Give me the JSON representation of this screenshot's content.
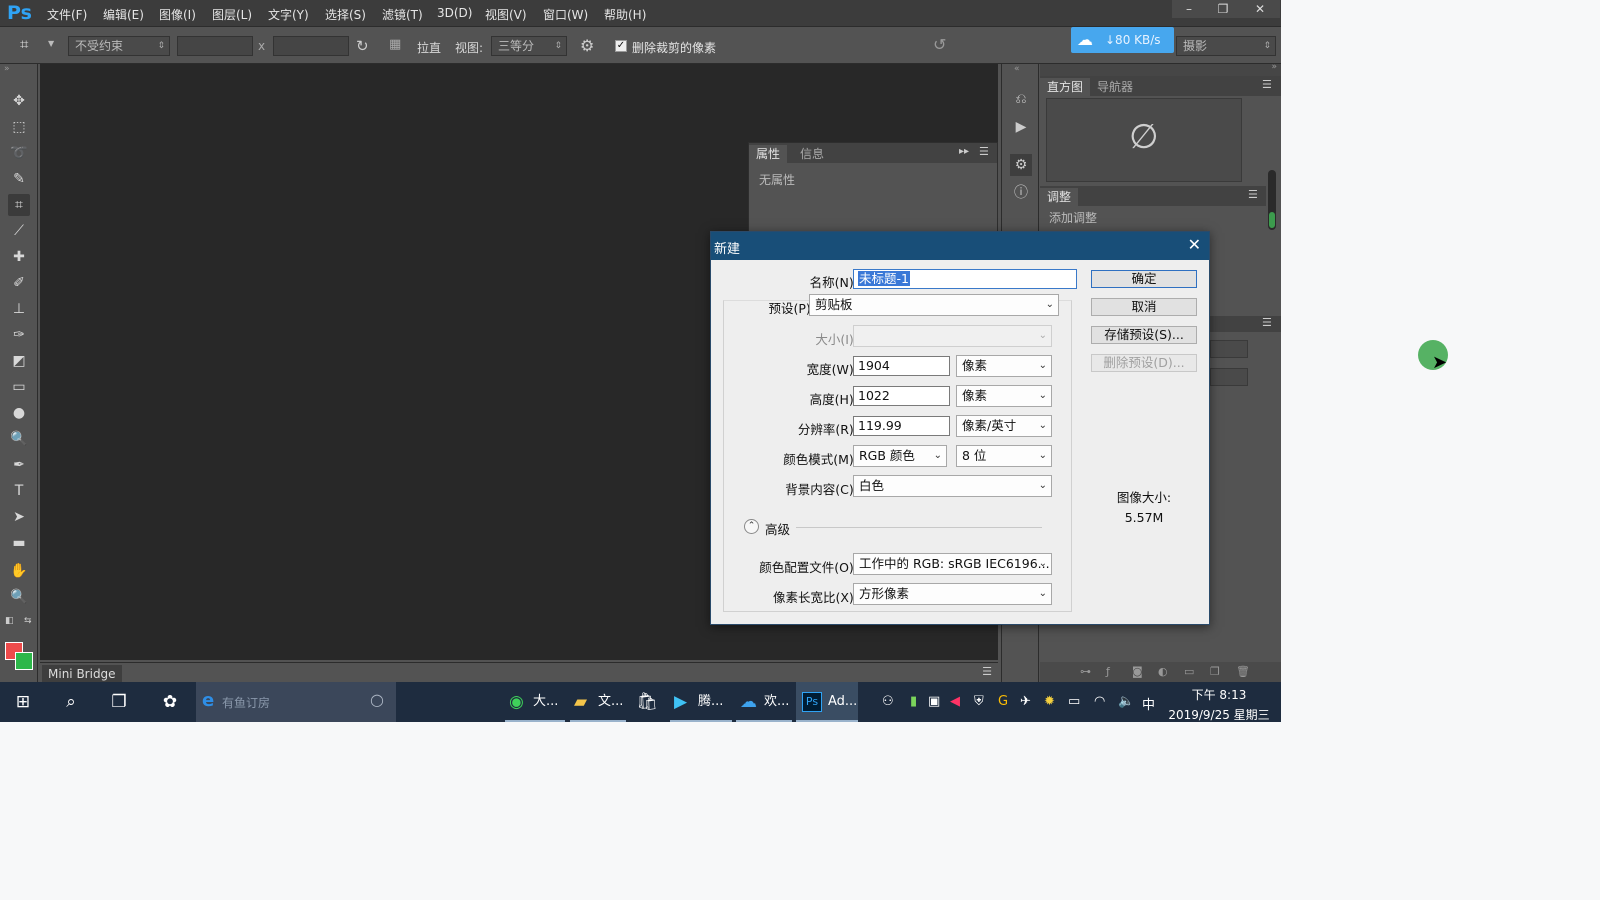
{
  "app": {
    "logo": "Ps",
    "menu": [
      "文件(F)",
      "编辑(E)",
      "图像(I)",
      "图层(L)",
      "文字(Y)",
      "选择(S)",
      "滤镜(T)",
      "3D(D)",
      "视图(V)",
      "窗口(W)",
      "帮助(H)"
    ],
    "window_buttons": [
      "–",
      "❐",
      "✕"
    ]
  },
  "options_bar": {
    "constraint": "不受约束",
    "x_sep": "x",
    "straighten": "拉直",
    "view_label": "视图:",
    "view_value": "三等分",
    "delete_cropped_label": "删除裁剪的像素",
    "delete_cropped_checked": true,
    "workspace": "摄影"
  },
  "cloud_widget": {
    "speed": "↓80 KB/s"
  },
  "panels": {
    "properties_tabs": [
      "属性",
      "信息"
    ],
    "properties_text": "无属性",
    "right_tabs": [
      "直方图",
      "导航器"
    ],
    "adjust_tab": "调整",
    "adjust_text": "添加调整",
    "mini_bridge": "Mini Bridge"
  },
  "dialog": {
    "title": "新建",
    "name_label": "名称(N):",
    "name_value": "未标题-1",
    "preset_label": "预设(P):",
    "preset_value": "剪贴板",
    "size_label": "大小(I):",
    "width_label": "宽度(W):",
    "width_value": "1904",
    "width_unit": "像素",
    "height_label": "高度(H):",
    "height_value": "1022",
    "height_unit": "像素",
    "resolution_label": "分辨率(R):",
    "resolution_value": "119.99",
    "resolution_unit": "像素/英寸",
    "color_mode_label": "颜色模式(M):",
    "color_mode_value": "RGB 颜色",
    "bit_depth": "8 位",
    "background_label": "背景内容(C):",
    "background_value": "白色",
    "advanced_label": "高级",
    "profile_label": "颜色配置文件(O):",
    "profile_value": "工作中的 RGB: sRGB IEC6196...",
    "aspect_label": "像素长宽比(X):",
    "aspect_value": "方形像素",
    "ok": "确定",
    "cancel": "取消",
    "save_preset": "存储预设(S)...",
    "delete_preset": "删除预设(D)...",
    "image_size_label": "图像大小:",
    "image_size_value": "5.57M"
  },
  "taskbar": {
    "search_placeholder": "有鱼订房",
    "apps": [
      "大...",
      "文...",
      "腾...",
      "欢...",
      "Ad..."
    ],
    "ime": "中",
    "time": "下午 8:13",
    "date": "2019/9/25 星期三"
  },
  "colors": {
    "ps_bg": "#535353",
    "canvas": "#282828",
    "dialog_title": "#184e78",
    "foreground": "#ee4b4b",
    "background": "#2db74a",
    "taskbar": "#1e2c3f"
  }
}
